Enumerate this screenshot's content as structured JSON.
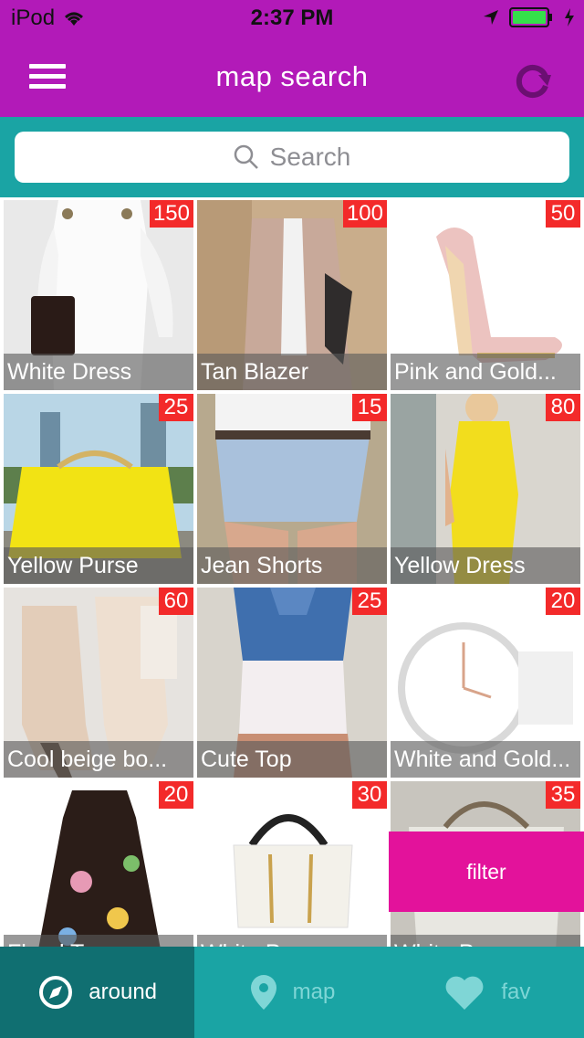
{
  "status": {
    "carrier": "iPod",
    "time": "2:37 PM"
  },
  "nav": {
    "title": "map search"
  },
  "search": {
    "placeholder": "Search"
  },
  "items": [
    {
      "name": "White Dress",
      "price": "150"
    },
    {
      "name": "Tan Blazer",
      "price": "100"
    },
    {
      "name": "Pink and Gold...",
      "price": "50"
    },
    {
      "name": "Yellow Purse",
      "price": "25"
    },
    {
      "name": "Jean Shorts",
      "price": "15"
    },
    {
      "name": "Yellow Dress",
      "price": "80"
    },
    {
      "name": "Cool beige bo...",
      "price": "60"
    },
    {
      "name": "Cute Top",
      "price": "25"
    },
    {
      "name": "White and Gold...",
      "price": "20"
    },
    {
      "name": "Floral Top",
      "price": "20"
    },
    {
      "name": "White Purse",
      "price": "30"
    },
    {
      "name": "White Purse",
      "price": "35"
    }
  ],
  "filter_label": "filter",
  "tabs": [
    {
      "label": "around",
      "icon": "compass-icon"
    },
    {
      "label": "map",
      "icon": "map-pin-icon"
    },
    {
      "label": "fav",
      "icon": "heart-icon"
    }
  ]
}
